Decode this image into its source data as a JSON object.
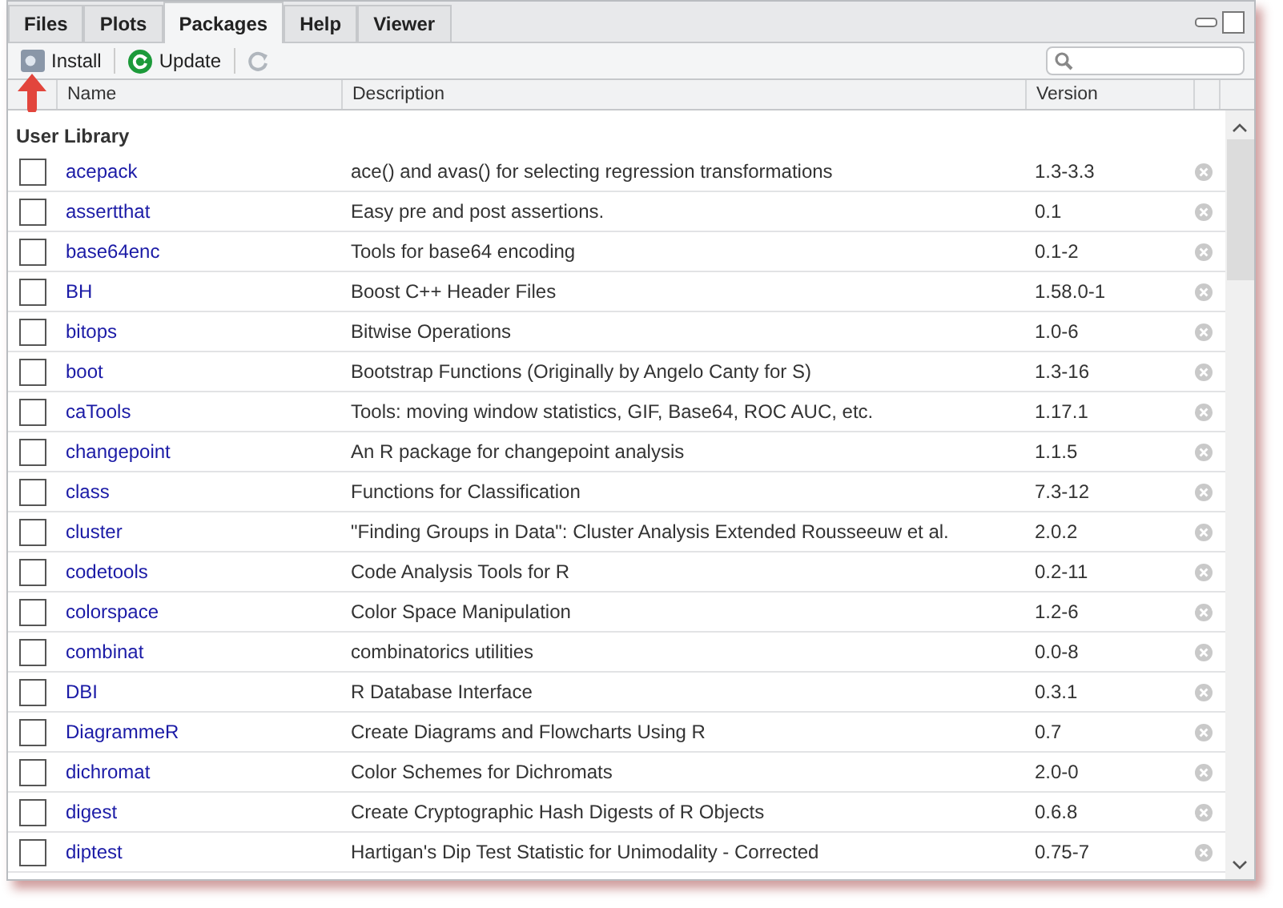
{
  "tabs": [
    {
      "label": "Files",
      "selected": false
    },
    {
      "label": "Plots",
      "selected": false
    },
    {
      "label": "Packages",
      "selected": true
    },
    {
      "label": "Help",
      "selected": false
    },
    {
      "label": "Viewer",
      "selected": false
    }
  ],
  "toolbar": {
    "install": "Install",
    "update": "Update"
  },
  "columns": [
    "Name",
    "Description",
    "Version"
  ],
  "section": "User Library",
  "packages": [
    {
      "name": "acepack",
      "description": "ace() and avas() for selecting regression transformations",
      "version": "1.3-3.3",
      "checked": false
    },
    {
      "name": "assertthat",
      "description": "Easy pre and post assertions.",
      "version": "0.1",
      "checked": false
    },
    {
      "name": "base64enc",
      "description": "Tools for base64 encoding",
      "version": "0.1-2",
      "checked": false
    },
    {
      "name": "BH",
      "description": "Boost C++ Header Files",
      "version": "1.58.0-1",
      "checked": false
    },
    {
      "name": "bitops",
      "description": "Bitwise Operations",
      "version": "1.0-6",
      "checked": false
    },
    {
      "name": "boot",
      "description": "Bootstrap Functions (Originally by Angelo Canty for S)",
      "version": "1.3-16",
      "checked": false
    },
    {
      "name": "caTools",
      "description": "Tools: moving window statistics, GIF, Base64, ROC AUC, etc.",
      "version": "1.17.1",
      "checked": false
    },
    {
      "name": "changepoint",
      "description": "An R package for changepoint analysis",
      "version": "1.1.5",
      "checked": false
    },
    {
      "name": "class",
      "description": "Functions for Classification",
      "version": "7.3-12",
      "checked": false
    },
    {
      "name": "cluster",
      "description": "\"Finding Groups in Data\": Cluster Analysis Extended Rousseeuw et al.",
      "version": "2.0.2",
      "checked": false
    },
    {
      "name": "codetools",
      "description": "Code Analysis Tools for R",
      "version": "0.2-11",
      "checked": false
    },
    {
      "name": "colorspace",
      "description": "Color Space Manipulation",
      "version": "1.2-6",
      "checked": false
    },
    {
      "name": "combinat",
      "description": "combinatorics utilities",
      "version": "0.0-8",
      "checked": false
    },
    {
      "name": "DBI",
      "description": "R Database Interface",
      "version": "0.3.1",
      "checked": false
    },
    {
      "name": "DiagrammeR",
      "description": "Create Diagrams and Flowcharts Using R",
      "version": "0.7",
      "checked": false
    },
    {
      "name": "dichromat",
      "description": "Color Schemes for Dichromats",
      "version": "2.0-0",
      "checked": false
    },
    {
      "name": "digest",
      "description": "Create Cryptographic Hash Digests of R Objects",
      "version": "0.6.8",
      "checked": false
    },
    {
      "name": "diptest",
      "description": "Hartigan's Dip Test Statistic for Unimodality - Corrected",
      "version": "0.75-7",
      "checked": false
    }
  ]
}
